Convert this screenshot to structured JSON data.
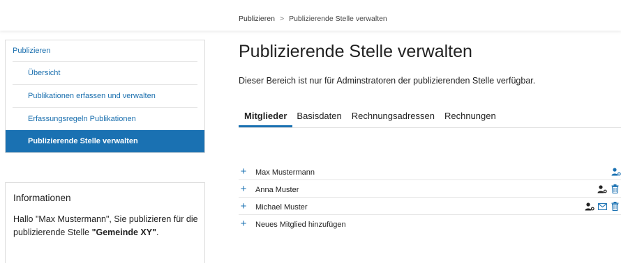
{
  "breadcrumb": {
    "root": "Publizieren",
    "separator": ">",
    "current": "Publizierende Stelle verwalten"
  },
  "sidebar": {
    "items": [
      {
        "label": "Publizieren"
      },
      {
        "label": "Übersicht"
      },
      {
        "label": "Publikationen erfassen und verwalten"
      },
      {
        "label": "Erfassungsregeln Publikationen"
      },
      {
        "label": "Publizierende Stelle verwalten",
        "active": true
      }
    ]
  },
  "info": {
    "title": "Informationen",
    "text_before": "Hallo \"Max Mustermann\", Sie publizieren für die publizierende Stelle ",
    "highlight": "\"Gemeinde XY\"",
    "text_after": "."
  },
  "main": {
    "title": "Publizierende Stelle verwalten",
    "description": "Dieser Bereich ist nur für Adminstratoren der publizierenden Stelle verfügbar.",
    "tabs": [
      {
        "label": "Mitglieder",
        "active": true
      },
      {
        "label": "Basisdaten"
      },
      {
        "label": "Rechnungsadressen"
      },
      {
        "label": "Rechnungen"
      }
    ]
  },
  "members": {
    "rows": [
      {
        "name": "Max Mustermann",
        "icons": [
          "user-admin-icon"
        ]
      },
      {
        "name": "Anna Muster",
        "icons": [
          "user-admin-icon",
          "trash-icon"
        ]
      },
      {
        "name": "Michael Muster",
        "icons": [
          "user-admin-icon",
          "mail-icon",
          "trash-icon"
        ]
      }
    ],
    "add_label": "Neues Mitglied hinzufügen",
    "plus_symbol": "+"
  },
  "colors": {
    "accent": "#1a71b2",
    "link": "#1a6fae",
    "text": "#222222",
    "border": "#dcdcdc"
  }
}
